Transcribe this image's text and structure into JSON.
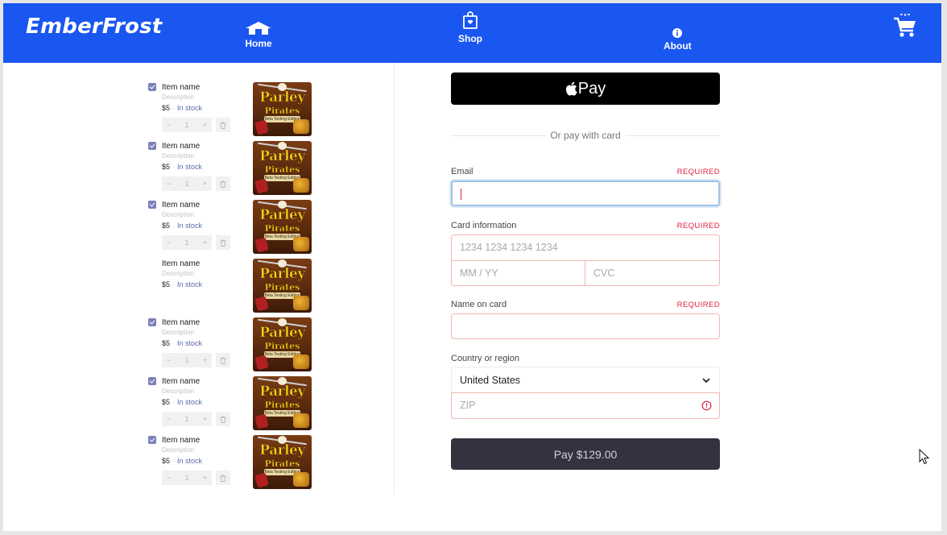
{
  "brand": {
    "name": "EmberFrost"
  },
  "nav": {
    "home": "Home",
    "shop": "Shop",
    "about": "About"
  },
  "cart_items": [
    {
      "name": "Item name",
      "description": "Description",
      "price": "$5",
      "stock": "In stock",
      "quantity": "1",
      "checked": true,
      "image_title": "Parley",
      "image_subtitle": "Pirates",
      "image_caption": "Beta Testing Edition"
    },
    {
      "name": "Item name",
      "description": "Description",
      "price": "$5",
      "stock": "In stock",
      "quantity": "1",
      "checked": true,
      "image_title": "Parley",
      "image_subtitle": "Pirates",
      "image_caption": "Beta Testing Edition"
    },
    {
      "name": "Item name",
      "description": "Description",
      "price": "$5",
      "stock": "In stock",
      "quantity": "1",
      "checked": true,
      "image_title": "Parley",
      "image_subtitle": "Pirates",
      "image_caption": "Beta Testing Edition"
    },
    {
      "name": "Item name",
      "description": "Description",
      "price": "$5",
      "stock": "In stock",
      "quantity": null,
      "checked": false,
      "image_title": "Parley",
      "image_subtitle": "Pirates",
      "image_caption": "Beta Testing Edition"
    },
    {
      "name": "Item name",
      "description": "Description",
      "price": "$5",
      "stock": "In stock",
      "quantity": "1",
      "checked": true,
      "image_title": "Parley",
      "image_subtitle": "Pirates",
      "image_caption": "Beta Testing Edition"
    },
    {
      "name": "Item name",
      "description": "Description",
      "price": "$5",
      "stock": "In stock",
      "quantity": "1",
      "checked": true,
      "image_title": "Parley",
      "image_subtitle": "Pirates",
      "image_caption": "Beta Testing Edition"
    },
    {
      "name": "Item name",
      "description": "Description",
      "price": "$5",
      "stock": "In stock",
      "quantity": "1",
      "checked": true,
      "image_title": "Parley",
      "image_subtitle": "Pirates",
      "image_caption": "Beta Testing Edition"
    }
  ],
  "stepper": {
    "minus": "−",
    "plus": "+"
  },
  "checkout": {
    "apple_pay_label": "Pay",
    "or_pay_with_card": "Or pay with card",
    "email_label": "Email",
    "required": "REQUIRED",
    "email_value": "",
    "card_info_label": "Card information",
    "card_number_placeholder": "1234 1234 1234 1234",
    "expiry_placeholder": "MM / YY",
    "cvc_placeholder": "CVC",
    "name_label": "Name on card",
    "name_value": "",
    "country_label": "Country or region",
    "country_value": "United States",
    "zip_placeholder": "ZIP",
    "pay_button": "Pay $129.00"
  },
  "colors": {
    "header_bg": "#1a56f0",
    "required": "#e01e3c",
    "pay_button_bg": "#35313f",
    "stock_text": "#5b6aa8"
  },
  "icons": {
    "home": "home-icon",
    "shop": "shopping-bag-icon",
    "about": "info-icon",
    "cart": "cart-icon",
    "apple": "apple-icon",
    "trash": "trash-icon",
    "chevron": "chevron-down-icon",
    "warning": "warning-circle-icon"
  }
}
